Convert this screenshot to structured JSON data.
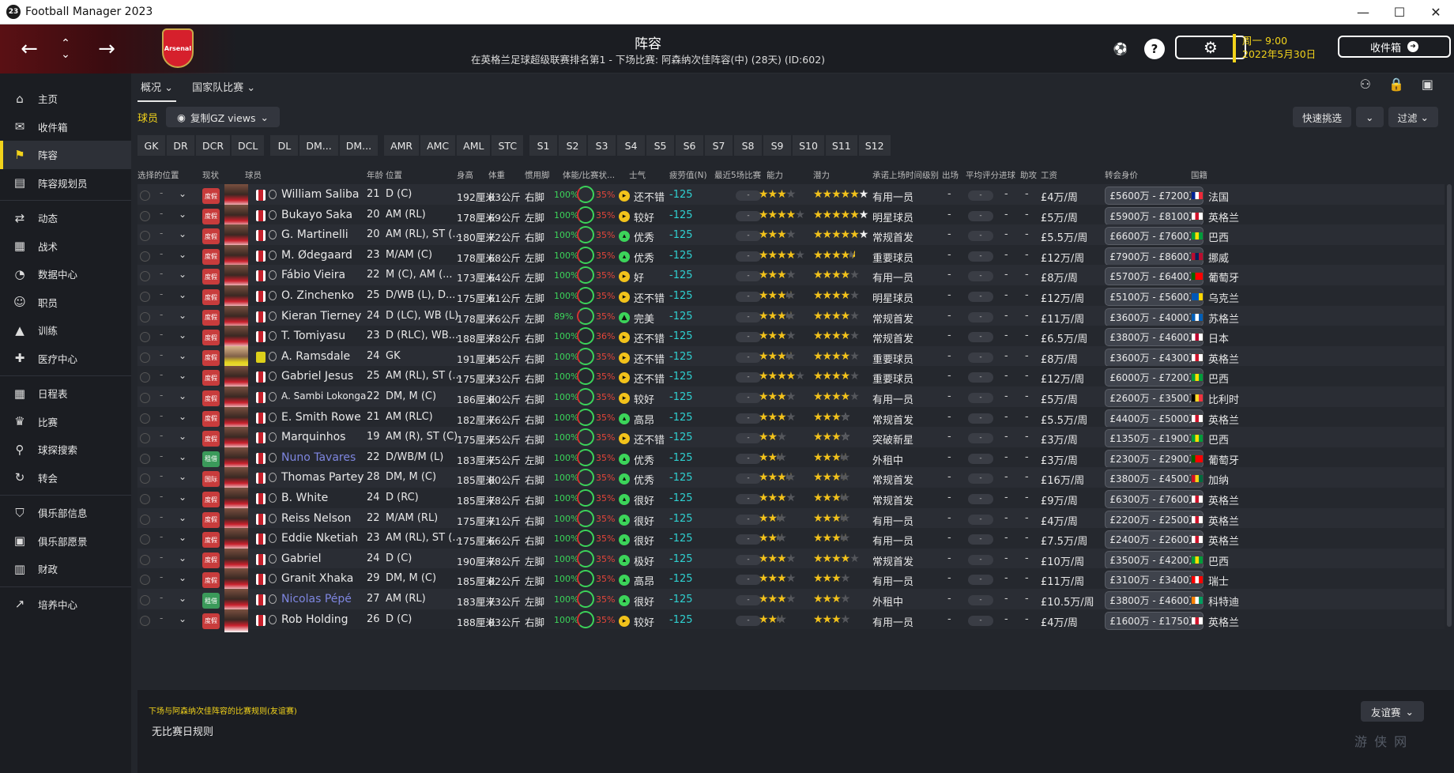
{
  "app": {
    "title": "Football Manager 2023",
    "logo": "23",
    "win_controls": [
      "—",
      "☐",
      "✕"
    ]
  },
  "header": {
    "title": "阵容",
    "subtitle": "在英格兰足球超级联赛排名第1 - 下场比赛: 阿森纳次佳阵容(中) (28天) (ID:602)",
    "crest_text": "Arsenal",
    "day": "周一 9:00",
    "date": "2022年5月30日",
    "inbox_label": "收件箱"
  },
  "sidebar": {
    "items": [
      {
        "label": "主页",
        "icon": "home-icon",
        "glyph": "⌂"
      },
      {
        "label": "收件箱",
        "icon": "inbox-icon",
        "glyph": "✉"
      },
      {
        "label": "阵容",
        "icon": "squad-icon",
        "glyph": "⚑",
        "active": true
      },
      {
        "label": "阵容规划员",
        "icon": "clipboard-icon",
        "glyph": "▤"
      },
      {
        "label": "动态",
        "icon": "dynamics-icon",
        "glyph": "⇄"
      },
      {
        "label": "战术",
        "icon": "tactics-icon",
        "glyph": "▦"
      },
      {
        "label": "数据中心",
        "icon": "data-hub-icon",
        "glyph": "◔"
      },
      {
        "label": "职员",
        "icon": "staff-icon",
        "glyph": "☺"
      },
      {
        "label": "训练",
        "icon": "training-icon",
        "glyph": "▲"
      },
      {
        "label": "医疗中心",
        "icon": "medical-icon",
        "glyph": "✚"
      },
      {
        "label": "日程表",
        "icon": "calendar-icon",
        "glyph": "▦"
      },
      {
        "label": "比赛",
        "icon": "trophy-icon",
        "glyph": "♛"
      },
      {
        "label": "球探搜索",
        "icon": "scouting-icon",
        "glyph": "⚲"
      },
      {
        "label": "转会",
        "icon": "transfers-icon",
        "glyph": "↻"
      },
      {
        "label": "俱乐部信息",
        "icon": "club-info-icon",
        "glyph": "⛉"
      },
      {
        "label": "俱乐部愿景",
        "icon": "club-vision-icon",
        "glyph": "▣"
      },
      {
        "label": "财政",
        "icon": "finances-icon",
        "glyph": "▥"
      },
      {
        "label": "培养中心",
        "icon": "development-icon",
        "glyph": "↗"
      }
    ]
  },
  "tabs": [
    {
      "label": "概况"
    },
    {
      "label": "国家队比赛"
    }
  ],
  "view": {
    "section_label": "球员",
    "view_name": "复制GZ views",
    "quick_pick": "快速挑选",
    "filter": "过滤"
  },
  "positions": [
    "GK",
    "DR",
    "DCR",
    "DCL",
    "DL",
    "DM...",
    "DM...",
    "AMR",
    "AMC",
    "AML",
    "STC",
    "S1",
    "S2",
    "S3",
    "S4",
    "S5",
    "S6",
    "S7",
    "S8",
    "S9",
    "S10",
    "S11",
    "S12"
  ],
  "columns": {
    "select_pos": "选择的位置",
    "status": "现状",
    "player": "球员",
    "age": "年龄",
    "position": "位置",
    "height": "身高",
    "weight": "体重",
    "foot": "惯用脚",
    "condition": "体能/比赛状...",
    "morale": "士气",
    "fatigue": "疲劳值(N)",
    "last5": "最近5场比赛",
    "ca": "能力",
    "pa": "潜力",
    "role": "承诺上场时间级别",
    "apps": "出场",
    "avg": "平均评分",
    "goals": "进球",
    "assists": "助攻",
    "wage": "工资",
    "value": "转会身价",
    "nation": "国籍"
  },
  "players": [
    {
      "status": "度假",
      "name": "William Saliba",
      "age": "21",
      "pos": "D (C)",
      "height": "192厘米",
      "weight": "83公斤",
      "foot": "右脚",
      "cond": "100%",
      "sharp": "35%",
      "morale": "还不错",
      "morale_color": "#f2c21b",
      "morale_glyph": "▸",
      "fatigue": "-125",
      "ca": 3,
      "ca_half": false,
      "pa": 5,
      "pa_half": false,
      "pa_white": 1,
      "role": "有用一员",
      "wage": "£4万/周",
      "value": "£5600万 - £7200万",
      "flag": [
        "#002395",
        "#ffffff",
        "#ed2939"
      ],
      "nation": "法国"
    },
    {
      "status": "度假",
      "name": "Bukayo Saka",
      "age": "20",
      "pos": "AM (RL)",
      "height": "178厘米",
      "weight": "69公斤",
      "foot": "左脚",
      "cond": "100%",
      "sharp": "35%",
      "morale": "较好",
      "morale_color": "#f2c21b",
      "morale_glyph": "▸",
      "fatigue": "-125",
      "ca": 4,
      "ca_half": false,
      "pa": 5,
      "pa_half": false,
      "pa_white": 1,
      "role": "明星球员",
      "wage": "£5万/周",
      "value": "£5900万 - £8100万",
      "flag": [
        "#ffffff",
        "#cf142b",
        "#ffffff"
      ],
      "nation": "英格兰"
    },
    {
      "status": "度假",
      "name": "G. Martinelli",
      "age": "20",
      "pos": "AM (RL), ST (...",
      "height": "180厘米",
      "weight": "72公斤",
      "foot": "右脚",
      "cond": "100%",
      "sharp": "35%",
      "morale": "优秀",
      "morale_color": "#3cd45a",
      "morale_glyph": "▴",
      "fatigue": "-125",
      "ca": 3,
      "ca_half": false,
      "pa": 5,
      "pa_half": false,
      "pa_white": 1,
      "role": "常规首发",
      "wage": "£5.5万/周",
      "value": "£6600万 - £7600万",
      "flag": [
        "#009c3b",
        "#ffdf00",
        "#009c3b"
      ],
      "nation": "巴西"
    },
    {
      "status": "度假",
      "name": "M. Ødegaard",
      "age": "23",
      "pos": "M/AM (C)",
      "height": "178厘米",
      "weight": "68公斤",
      "foot": "左脚",
      "cond": "100%",
      "sharp": "35%",
      "morale": "优秀",
      "morale_color": "#3cd45a",
      "morale_glyph": "▴",
      "fatigue": "-125",
      "ca": 4,
      "ca_half": false,
      "pa": 4,
      "pa_half": true,
      "pa_white": 0,
      "role": "重要球员",
      "wage": "£12万/周",
      "value": "£7900万 - £8600万",
      "flag": [
        "#ba0c2f",
        "#00205b",
        "#ba0c2f"
      ],
      "nation": "挪威"
    },
    {
      "status": "度假",
      "name": "Fábio Vieira",
      "age": "22",
      "pos": "M (C), AM (...",
      "height": "173厘米",
      "weight": "64公斤",
      "foot": "左脚",
      "cond": "100%",
      "sharp": "35%",
      "morale": "好",
      "morale_color": "#f2c21b",
      "morale_glyph": "▸",
      "fatigue": "-125",
      "ca": 3,
      "ca_half": false,
      "pa": 4,
      "pa_half": false,
      "pa_white": 0,
      "role": "有用一员",
      "wage": "£8万/周",
      "value": "£5700万 - £6400万",
      "flag": [
        "#006600",
        "#ff0000",
        "#ff0000"
      ],
      "nation": "葡萄牙"
    },
    {
      "status": "度假",
      "name": "O. Zinchenko",
      "age": "25",
      "pos": "D/WB (L), D...",
      "height": "175厘米",
      "weight": "61公斤",
      "foot": "左脚",
      "cond": "100%",
      "sharp": "35%",
      "morale": "还不错",
      "morale_color": "#f2c21b",
      "morale_glyph": "▸",
      "fatigue": "-125",
      "ca": 3,
      "ca_half": true,
      "pa": 4,
      "pa_half": false,
      "pa_white": 0,
      "role": "明星球员",
      "wage": "£12万/周",
      "value": "£5100万 - £5600万",
      "flag": [
        "#0057b7",
        "#0057b7",
        "#ffd700"
      ],
      "nation": "乌克兰"
    },
    {
      "status": "度假",
      "name": "Kieran Tierney",
      "age": "24",
      "pos": "D (LC), WB (L)",
      "height": "178厘米",
      "weight": "76公斤",
      "foot": "左脚",
      "cond": "89%",
      "sharp": "35%",
      "morale": "完美",
      "morale_color": "#3cd45a",
      "morale_glyph": "▲",
      "fatigue": "-125",
      "ca": 3,
      "ca_half": true,
      "pa": 4,
      "pa_half": false,
      "pa_white": 0,
      "role": "常规首发",
      "wage": "£11万/周",
      "value": "£3600万 - £4000万",
      "flag": [
        "#005eb8",
        "#ffffff",
        "#005eb8"
      ],
      "nation": "苏格兰"
    },
    {
      "status": "度假",
      "name": "T. Tomiyasu",
      "age": "23",
      "pos": "D (RLC), WB...",
      "height": "188厘米",
      "weight": "78公斤",
      "foot": "右脚",
      "cond": "100%",
      "sharp": "36%",
      "morale": "还不错",
      "morale_color": "#f2c21b",
      "morale_glyph": "▸",
      "fatigue": "-125",
      "ca": 3,
      "ca_half": false,
      "pa": 4,
      "pa_half": false,
      "pa_white": 0,
      "role": "常规首发",
      "wage": "£6.5万/周",
      "value": "£3800万 - £4600万",
      "flag": [
        "#ffffff",
        "#bc002d",
        "#ffffff"
      ],
      "nation": "日本"
    },
    {
      "status": "度假",
      "name": "A. Ramsdale",
      "age": "24",
      "pos": "GK",
      "height": "191厘米",
      "weight": "85公斤",
      "foot": "右脚",
      "cond": "100%",
      "sharp": "35%",
      "morale": "还不错",
      "morale_color": "#f2c21b",
      "morale_glyph": "▸",
      "fatigue": "-125",
      "ca": 3,
      "ca_half": true,
      "pa": 4,
      "pa_half": false,
      "pa_white": 0,
      "role": "重要球员",
      "wage": "£8万/周",
      "value": "£3600万 - £4300万",
      "flag": [
        "#ffffff",
        "#cf142b",
        "#ffffff"
      ],
      "nation": "英格兰",
      "gk": true
    },
    {
      "status": "度假",
      "name": "Gabriel Jesus",
      "age": "25",
      "pos": "AM (RL), ST (...",
      "height": "175厘米",
      "weight": "73公斤",
      "foot": "右脚",
      "cond": "100%",
      "sharp": "35%",
      "morale": "还不错",
      "morale_color": "#f2c21b",
      "morale_glyph": "▸",
      "fatigue": "-125",
      "ca": 4,
      "ca_half": false,
      "pa": 4,
      "pa_half": false,
      "pa_white": 0,
      "role": "重要球员",
      "wage": "£12万/周",
      "value": "£6000万 - £7200万",
      "flag": [
        "#009c3b",
        "#ffdf00",
        "#009c3b"
      ],
      "nation": "巴西"
    },
    {
      "status": "度假",
      "name": "A. Sambi Lokonga",
      "age": "22",
      "pos": "DM, M (C)",
      "height": "186厘米",
      "weight": "80公斤",
      "foot": "右脚",
      "cond": "100%",
      "sharp": "35%",
      "morale": "较好",
      "morale_color": "#f2c21b",
      "morale_glyph": "▸",
      "fatigue": "-125",
      "ca": 3,
      "ca_half": false,
      "pa": 4,
      "pa_half": false,
      "pa_white": 0,
      "role": "有用一员",
      "wage": "£5万/周",
      "value": "£2600万 - £3500万",
      "flag": [
        "#000000",
        "#fdda24",
        "#ef3340"
      ],
      "nation": "比利时",
      "small": true
    },
    {
      "status": "度假",
      "name": "E. Smith Rowe",
      "age": "21",
      "pos": "AM (RLC)",
      "height": "182厘米",
      "weight": "76公斤",
      "foot": "右脚",
      "cond": "100%",
      "sharp": "35%",
      "morale": "高昂",
      "morale_color": "#3cd45a",
      "morale_glyph": "▴",
      "fatigue": "-125",
      "ca": 3,
      "ca_half": false,
      "pa": 3,
      "pa_half": false,
      "pa_white": 1,
      "role": "常规首发",
      "wage": "£5.5万/周",
      "value": "£4400万 - £5000万",
      "flag": [
        "#ffffff",
        "#cf142b",
        "#ffffff"
      ],
      "nation": "英格兰"
    },
    {
      "status": "度假",
      "name": "Marquinhos",
      "age": "19",
      "pos": "AM (R), ST (C)",
      "height": "175厘米",
      "weight": "75公斤",
      "foot": "右脚",
      "cond": "100%",
      "sharp": "35%",
      "morale": "还不错",
      "morale_color": "#f2c21b",
      "morale_glyph": "▸",
      "fatigue": "-125",
      "ca": 2,
      "ca_half": false,
      "pa": 3,
      "pa_half": false,
      "pa_white": 1,
      "role": "突破新星",
      "wage": "£3万/周",
      "value": "£1350万 - £1900万",
      "flag": [
        "#009c3b",
        "#ffdf00",
        "#009c3b"
      ],
      "nation": "巴西"
    },
    {
      "status": "租借",
      "name": "Nuno Tavares",
      "age": "22",
      "pos": "D/WB/M (L)",
      "height": "183厘米",
      "weight": "75公斤",
      "foot": "左脚",
      "cond": "100%",
      "sharp": "35%",
      "morale": "优秀",
      "morale_color": "#3cd45a",
      "morale_glyph": "▴",
      "fatigue": "-125",
      "ca": 2,
      "ca_half": true,
      "pa": 3,
      "pa_half": true,
      "pa_white": 0,
      "role": "外租中",
      "wage": "£3万/周",
      "value": "£2300万 - £2900万",
      "flag": [
        "#006600",
        "#ff0000",
        "#ff0000"
      ],
      "nation": "葡萄牙",
      "loan": true
    },
    {
      "status": "国际",
      "name": "Thomas Partey",
      "age": "28",
      "pos": "DM, M (C)",
      "height": "185厘米",
      "weight": "80公斤",
      "foot": "右脚",
      "cond": "100%",
      "sharp": "35%",
      "morale": "优秀",
      "morale_color": "#3cd45a",
      "morale_glyph": "▴",
      "fatigue": "-125",
      "ca": 3,
      "ca_half": true,
      "pa": 3,
      "pa_half": true,
      "pa_white": 0,
      "role": "常规首发",
      "wage": "£16万/周",
      "value": "£3800万 - £4500万",
      "flag": [
        "#ce1126",
        "#fcd116",
        "#006b3f"
      ],
      "nation": "加纳"
    },
    {
      "status": "度假",
      "name": "B. White",
      "age": "24",
      "pos": "D (RC)",
      "height": "185厘米",
      "weight": "78公斤",
      "foot": "右脚",
      "cond": "100%",
      "sharp": "35%",
      "morale": "很好",
      "morale_color": "#3cd45a",
      "morale_glyph": "▴",
      "fatigue": "-125",
      "ca": 3,
      "ca_half": false,
      "pa": 3,
      "pa_half": true,
      "pa_white": 0,
      "role": "常规首发",
      "wage": "£9万/周",
      "value": "£6300万 - £7600万",
      "flag": [
        "#ffffff",
        "#cf142b",
        "#ffffff"
      ],
      "nation": "英格兰"
    },
    {
      "status": "度假",
      "name": "Reiss Nelson",
      "age": "22",
      "pos": "M/AM (RL)",
      "height": "175厘米",
      "weight": "71公斤",
      "foot": "右脚",
      "cond": "100%",
      "sharp": "35%",
      "morale": "很好",
      "morale_color": "#3cd45a",
      "morale_glyph": "▴",
      "fatigue": "-125",
      "ca": 2,
      "ca_half": true,
      "pa": 3,
      "pa_half": true,
      "pa_white": 0,
      "role": "有用一员",
      "wage": "£4万/周",
      "value": "£2200万 - £2500万",
      "flag": [
        "#ffffff",
        "#cf142b",
        "#ffffff"
      ],
      "nation": "英格兰"
    },
    {
      "status": "度假",
      "name": "Eddie Nketiah",
      "age": "23",
      "pos": "AM (RL), ST (...",
      "height": "175厘米",
      "weight": "66公斤",
      "foot": "右脚",
      "cond": "100%",
      "sharp": "35%",
      "morale": "很好",
      "morale_color": "#3cd45a",
      "morale_glyph": "▴",
      "fatigue": "-125",
      "ca": 2,
      "ca_half": true,
      "pa": 3,
      "pa_half": true,
      "pa_white": 0,
      "role": "有用一员",
      "wage": "£7.5万/周",
      "value": "£2400万 - £2600万",
      "flag": [
        "#ffffff",
        "#cf142b",
        "#ffffff"
      ],
      "nation": "英格兰"
    },
    {
      "status": "度假",
      "name": "Gabriel",
      "age": "24",
      "pos": "D (C)",
      "height": "190厘米",
      "weight": "78公斤",
      "foot": "左脚",
      "cond": "100%",
      "sharp": "35%",
      "morale": "极好",
      "morale_color": "#3cd45a",
      "morale_glyph": "▴",
      "fatigue": "-125",
      "ca": 3,
      "ca_half": false,
      "pa": 4,
      "pa_half": false,
      "pa_white": 0,
      "role": "常规首发",
      "wage": "£10万/周",
      "value": "£3500万 - £4200万",
      "flag": [
        "#009c3b",
        "#ffdf00",
        "#009c3b"
      ],
      "nation": "巴西"
    },
    {
      "status": "度假",
      "name": "Granit Xhaka",
      "age": "29",
      "pos": "DM, M (C)",
      "height": "185厘米",
      "weight": "82公斤",
      "foot": "左脚",
      "cond": "100%",
      "sharp": "35%",
      "morale": "高昂",
      "morale_color": "#3cd45a",
      "morale_glyph": "▴",
      "fatigue": "-125",
      "ca": 3,
      "ca_half": false,
      "pa": 3,
      "pa_half": false,
      "pa_white": 0,
      "role": "有用一员",
      "wage": "£11万/周",
      "value": "£3100万 - £3400万",
      "flag": [
        "#ff0000",
        "#ffffff",
        "#ff0000"
      ],
      "nation": "瑞士"
    },
    {
      "status": "租借",
      "name": "Nicolas Pépé",
      "age": "27",
      "pos": "AM (RL)",
      "height": "183厘米",
      "weight": "73公斤",
      "foot": "左脚",
      "cond": "100%",
      "sharp": "35%",
      "morale": "很好",
      "morale_color": "#3cd45a",
      "morale_glyph": "▴",
      "fatigue": "-125",
      "ca": 3,
      "ca_half": false,
      "pa": 3,
      "pa_half": false,
      "pa_white": 0,
      "role": "外租中",
      "wage": "£10.5万/周",
      "value": "£3800万 - £4600万",
      "flag": [
        "#f77f00",
        "#ffffff",
        "#009e60"
      ],
      "nation": "科特迪",
      "loan": true
    },
    {
      "status": "度假",
      "name": "Rob Holding",
      "age": "26",
      "pos": "D (C)",
      "height": "188厘米",
      "weight": "83公斤",
      "foot": "右脚",
      "cond": "100%",
      "sharp": "35%",
      "morale": "较好",
      "morale_color": "#f2c21b",
      "morale_glyph": "▸",
      "fatigue": "-125",
      "ca": 2,
      "ca_half": true,
      "pa": 3,
      "pa_half": false,
      "pa_white": 0,
      "role": "有用一员",
      "wage": "£4万/周",
      "value": "£1600万 - £1750万",
      "flag": [
        "#ffffff",
        "#cf142b",
        "#ffffff"
      ],
      "nation": "英格兰"
    }
  ],
  "placeholder_dash": "-",
  "status_colors": {
    "度假": "#c83c3c",
    "租借": "#3a9a5a",
    "国际": "#c83c3c"
  },
  "bottom": {
    "rule_label": "下场与阿森纳次佳阵容的比赛规则(友谊赛)",
    "rule_value": "无比赛日规则",
    "friendly": "友谊赛",
    "watermark": "游 侠 网"
  },
  "colors": {
    "accent": "#f2d31b",
    "bg": "#23262c",
    "sidebar": "#1b1d22"
  }
}
